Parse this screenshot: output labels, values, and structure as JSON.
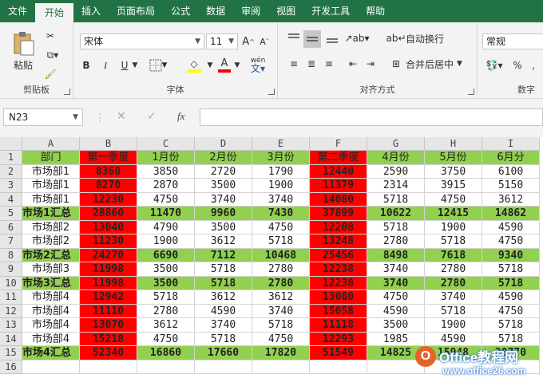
{
  "tabs": [
    "文件",
    "开始",
    "插入",
    "页面布局",
    "公式",
    "数据",
    "审阅",
    "视图",
    "开发工具",
    "帮助"
  ],
  "active_tab": "开始",
  "ribbon": {
    "clipboard": {
      "paste_label": "粘贴",
      "group_label": "剪贴板"
    },
    "font": {
      "font_name": "宋体",
      "font_size": "11",
      "bold": "B",
      "italic": "I",
      "underline": "U",
      "group_label": "字体",
      "wen": "wén"
    },
    "alignment": {
      "wrap_label": "自动换行",
      "merge_label": "合并后居中",
      "group_label": "对齐方式"
    },
    "number": {
      "format": "常规",
      "percent": "%",
      "comma": ",",
      "group_label": "数字"
    }
  },
  "formula_bar": {
    "name_box": "N23",
    "fx": "fx"
  },
  "grid": {
    "columns": [
      "A",
      "B",
      "C",
      "D",
      "E",
      "F",
      "G",
      "H",
      "I"
    ],
    "rows": [
      [
        "部门",
        "第一季度",
        "1月份",
        "2月份",
        "3月份",
        "第二季度",
        "4月份",
        "5月份",
        "6月分"
      ],
      [
        "市场部1",
        "8360",
        "3850",
        "2720",
        "1790",
        "12440",
        "2590",
        "3750",
        "6100"
      ],
      [
        "市场部1",
        "8270",
        "2870",
        "3500",
        "1900",
        "11379",
        "2314",
        "3915",
        "5150"
      ],
      [
        "市场部1",
        "12230",
        "4750",
        "3740",
        "3740",
        "14080",
        "5718",
        "4750",
        "3612"
      ],
      [
        "市场1汇总",
        "28860",
        "11470",
        "9960",
        "7430",
        "37899",
        "10622",
        "12415",
        "14862"
      ],
      [
        "市场部2",
        "13040",
        "4790",
        "3500",
        "4750",
        "12208",
        "5718",
        "1900",
        "4590"
      ],
      [
        "市场部2",
        "11230",
        "1900",
        "3612",
        "5718",
        "13248",
        "2780",
        "5718",
        "4750"
      ],
      [
        "市场2汇总",
        "24270",
        "6690",
        "7112",
        "10468",
        "25456",
        "8498",
        "7618",
        "9340"
      ],
      [
        "市场部3",
        "11998",
        "3500",
        "5718",
        "2780",
        "12238",
        "3740",
        "2780",
        "5718"
      ],
      [
        "市场3汇总",
        "11998",
        "3500",
        "5718",
        "2780",
        "12238",
        "3740",
        "2780",
        "5718"
      ],
      [
        "市场部4",
        "12942",
        "5718",
        "3612",
        "3612",
        "13080",
        "4750",
        "3740",
        "4590"
      ],
      [
        "市场部4",
        "11110",
        "2780",
        "4590",
        "3740",
        "15058",
        "4590",
        "5718",
        "4750"
      ],
      [
        "市场部4",
        "13070",
        "3612",
        "3740",
        "5718",
        "11118",
        "3500",
        "1900",
        "5718"
      ],
      [
        "市场部4",
        "15218",
        "4750",
        "5718",
        "4750",
        "12293",
        "1985",
        "4590",
        "5718"
      ],
      [
        "市场4汇总",
        "52340",
        "16860",
        "17660",
        "17820",
        "51549",
        "14825",
        "15948",
        "20770"
      ],
      [
        "",
        "",
        "",
        "",
        "",
        "",
        "",
        "",
        ""
      ]
    ],
    "summary_rows": [
      5,
      8,
      10,
      15
    ],
    "colors": {
      "green": "#92d050",
      "red": "#ff0000",
      "header": "#e6e6e6",
      "accent": "#217346"
    }
  },
  "watermark": {
    "line1": "Office教程网",
    "line2": "www.office26.com"
  }
}
